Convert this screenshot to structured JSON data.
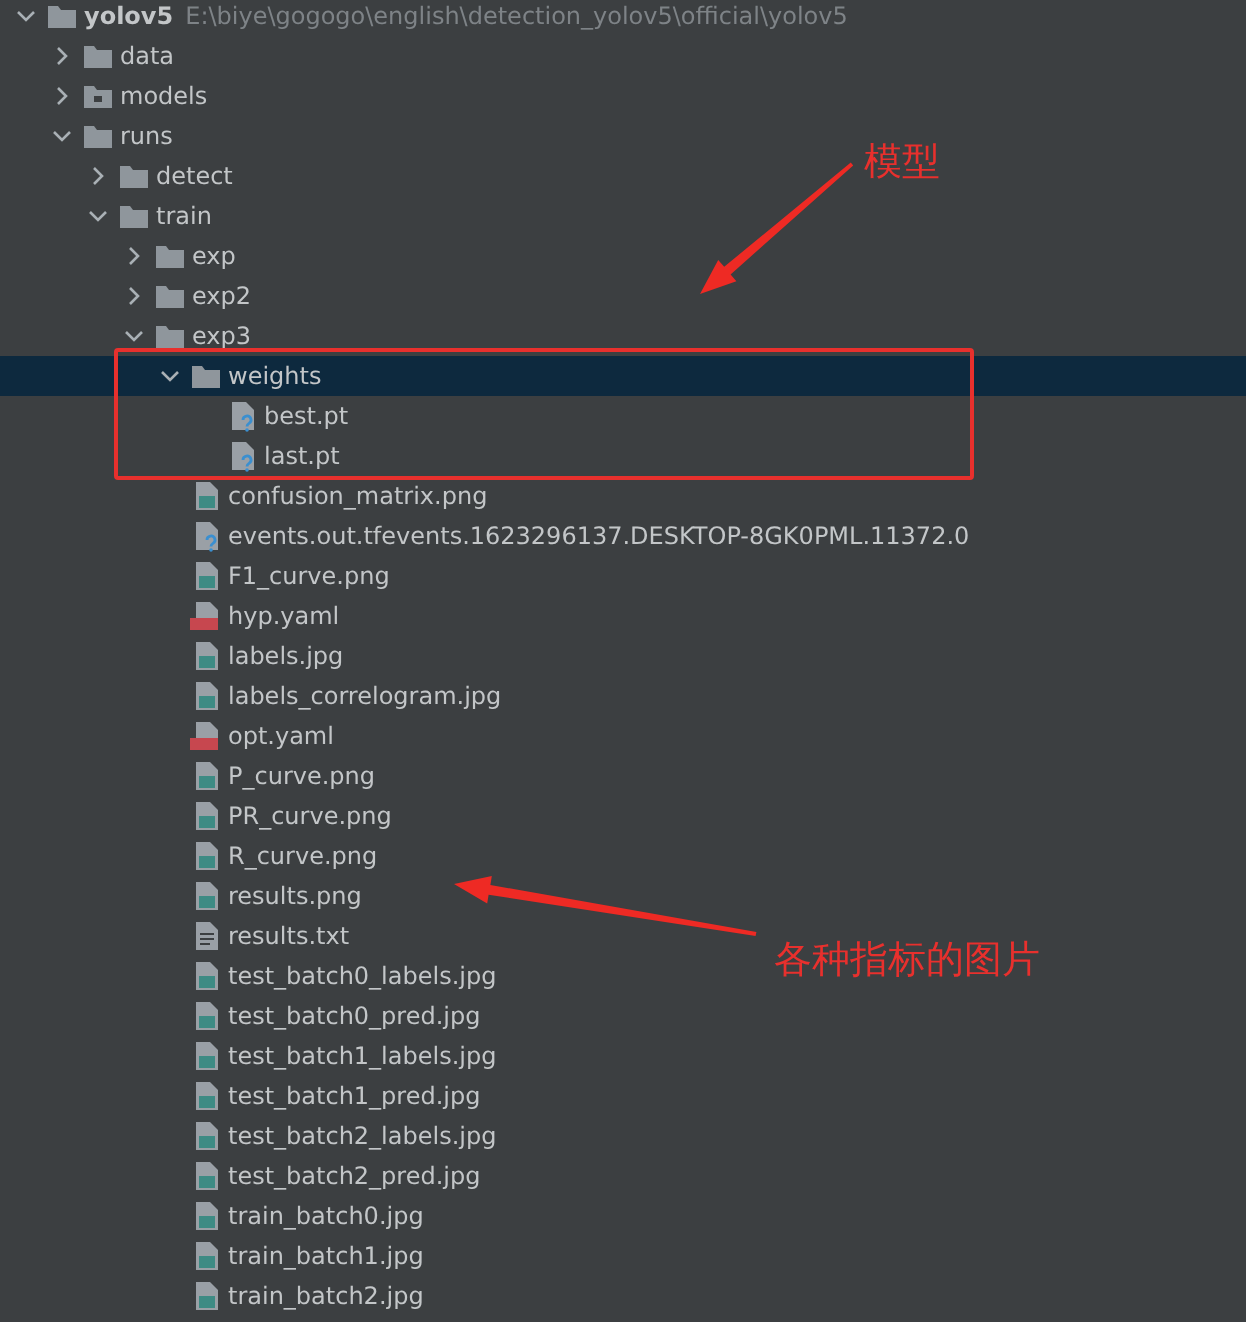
{
  "project_tree": [
    {
      "name": "yolov5",
      "path": "E:\\biye\\gogogo\\english\\detection_yolov5\\official\\yolov5",
      "kind": "folder",
      "expanded": true,
      "selected": false,
      "children": [
        {
          "name": "data",
          "kind": "folder",
          "expanded": false,
          "selected": false
        },
        {
          "name": "models",
          "kind": "package",
          "expanded": false,
          "selected": false
        },
        {
          "name": "runs",
          "kind": "folder",
          "expanded": true,
          "selected": false,
          "children": [
            {
              "name": "detect",
              "kind": "folder",
              "expanded": false,
              "selected": false
            },
            {
              "name": "train",
              "kind": "folder",
              "expanded": true,
              "selected": false,
              "children": [
                {
                  "name": "exp",
                  "kind": "folder",
                  "expanded": false,
                  "selected": false
                },
                {
                  "name": "exp2",
                  "kind": "folder",
                  "expanded": false,
                  "selected": false
                },
                {
                  "name": "exp3",
                  "kind": "folder",
                  "expanded": true,
                  "selected": false,
                  "children": [
                    {
                      "name": "weights",
                      "kind": "folder",
                      "expanded": true,
                      "selected": true,
                      "children": [
                        {
                          "name": "best.pt",
                          "kind": "unknown",
                          "selected": false
                        },
                        {
                          "name": "last.pt",
                          "kind": "unknown",
                          "selected": false
                        }
                      ]
                    },
                    {
                      "name": "confusion_matrix.png",
                      "kind": "image",
                      "selected": false
                    },
                    {
                      "name": "events.out.tfevents.1623296137.DESKTOP-8GK0PML.11372.0",
                      "kind": "unknown",
                      "selected": false
                    },
                    {
                      "name": "F1_curve.png",
                      "kind": "image",
                      "selected": false
                    },
                    {
                      "name": "hyp.yaml",
                      "kind": "yaml",
                      "selected": false
                    },
                    {
                      "name": "labels.jpg",
                      "kind": "image",
                      "selected": false
                    },
                    {
                      "name": "labels_correlogram.jpg",
                      "kind": "image",
                      "selected": false
                    },
                    {
                      "name": "opt.yaml",
                      "kind": "yaml",
                      "selected": false
                    },
                    {
                      "name": "P_curve.png",
                      "kind": "image",
                      "selected": false
                    },
                    {
                      "name": "PR_curve.png",
                      "kind": "image",
                      "selected": false
                    },
                    {
                      "name": "R_curve.png",
                      "kind": "image",
                      "selected": false
                    },
                    {
                      "name": "results.png",
                      "kind": "image",
                      "selected": false
                    },
                    {
                      "name": "results.txt",
                      "kind": "text",
                      "selected": false
                    },
                    {
                      "name": "test_batch0_labels.jpg",
                      "kind": "image",
                      "selected": false
                    },
                    {
                      "name": "test_batch0_pred.jpg",
                      "kind": "image",
                      "selected": false
                    },
                    {
                      "name": "test_batch1_labels.jpg",
                      "kind": "image",
                      "selected": false
                    },
                    {
                      "name": "test_batch1_pred.jpg",
                      "kind": "image",
                      "selected": false
                    },
                    {
                      "name": "test_batch2_labels.jpg",
                      "kind": "image",
                      "selected": false
                    },
                    {
                      "name": "test_batch2_pred.jpg",
                      "kind": "image",
                      "selected": false
                    },
                    {
                      "name": "train_batch0.jpg",
                      "kind": "image",
                      "selected": false
                    },
                    {
                      "name": "train_batch1.jpg",
                      "kind": "image",
                      "selected": false
                    },
                    {
                      "name": "train_batch2.jpg",
                      "kind": "image",
                      "selected": false
                    }
                  ]
                }
              ]
            }
          ]
        }
      ]
    }
  ],
  "annotations": [
    {
      "kind": "box"
    },
    {
      "kind": "arrow",
      "label": "模型"
    },
    {
      "kind": "arrow",
      "label": "各种指标的图片"
    }
  ]
}
